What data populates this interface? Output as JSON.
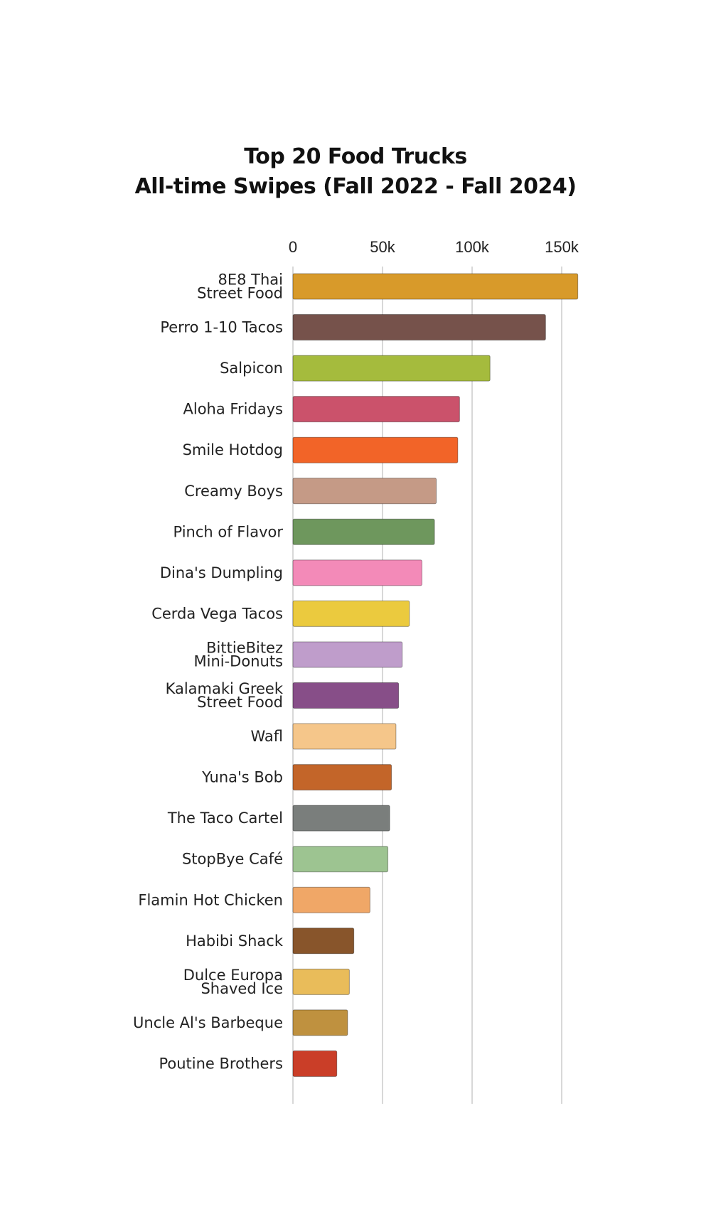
{
  "chart_data": {
    "type": "bar",
    "orientation": "horizontal",
    "title": [
      "Top 20 Food Trucks",
      "All-time Swipes (Fall 2022 - Fall 2024)"
    ],
    "xlabel": "",
    "ylabel": "",
    "xlim": [
      0,
      160000
    ],
    "x_ticks": [
      {
        "value": 0,
        "label": "0"
      },
      {
        "value": 50000,
        "label": "50k"
      },
      {
        "value": 100000,
        "label": "100k"
      },
      {
        "value": 150000,
        "label": "150k"
      }
    ],
    "grid": "vertical",
    "legend": "none",
    "categories": [
      [
        "8E8 Thai",
        "Street Food"
      ],
      [
        "Perro 1-10 Tacos"
      ],
      [
        "Salpicon"
      ],
      [
        "Aloha Fridays"
      ],
      [
        "Smile Hotdog"
      ],
      [
        "Creamy Boys"
      ],
      [
        "Pinch of Flavor"
      ],
      [
        "Dina's Dumpling"
      ],
      [
        "Cerda Vega Tacos"
      ],
      [
        "BittieBitez",
        "Mini-Donuts"
      ],
      [
        "Kalamaki Greek",
        "Street Food"
      ],
      [
        "Wafl"
      ],
      [
        "Yuna's Bob"
      ],
      [
        "The Taco Cartel"
      ],
      [
        "StopBye Café"
      ],
      [
        "Flamin Hot Chicken"
      ],
      [
        "Habibi Shack"
      ],
      [
        "Dulce Europa",
        "Shaved Ice"
      ],
      [
        "Uncle Al's Barbeque"
      ],
      [
        "Poutine Brothers"
      ]
    ],
    "values": [
      159000,
      141000,
      110000,
      93000,
      92000,
      80000,
      79000,
      72000,
      65000,
      61000,
      59000,
      57500,
      55000,
      54000,
      53000,
      43000,
      34000,
      31500,
      30500,
      24500
    ],
    "colors": [
      "#D89A2A",
      "#76524B",
      "#A5BB3D",
      "#CB526B",
      "#F26428",
      "#C59A86",
      "#6E975D",
      "#F38AB8",
      "#EBCA3E",
      "#BF9DCB",
      "#874E88",
      "#F5C68A",
      "#C36529",
      "#7A7E7C",
      "#9DC491",
      "#F0A767",
      "#88552B",
      "#E9BC5A",
      "#BF913F",
      "#CA3E28"
    ]
  }
}
